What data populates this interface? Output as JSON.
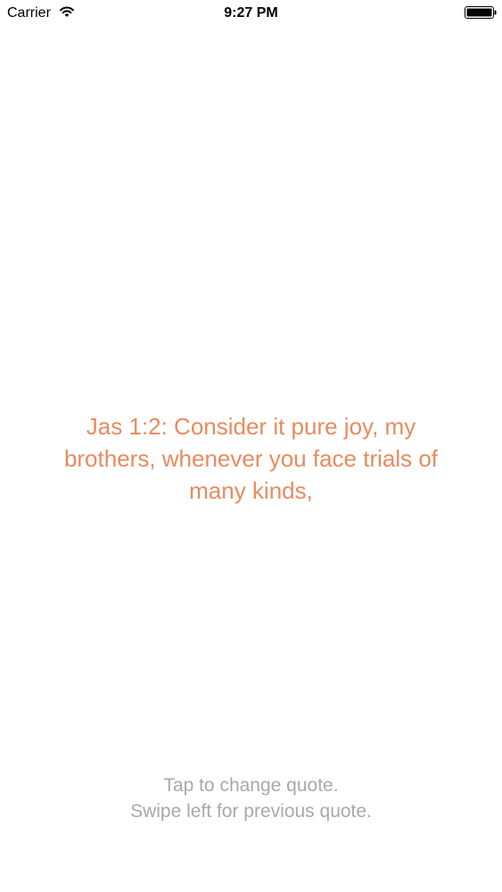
{
  "status_bar": {
    "carrier": "Carrier",
    "time": "9:27 PM",
    "wifi_icon": "wifi-icon",
    "battery_icon": "battery-icon"
  },
  "quote": {
    "text": "Jas 1:2: Consider it pure joy, my brothers, whenever you face trials of many kinds,",
    "color": "#e88b5e"
  },
  "instructions": {
    "line1": "Tap to change quote.",
    "line2": "Swipe left for previous quote.",
    "color": "#a8a8ae"
  }
}
